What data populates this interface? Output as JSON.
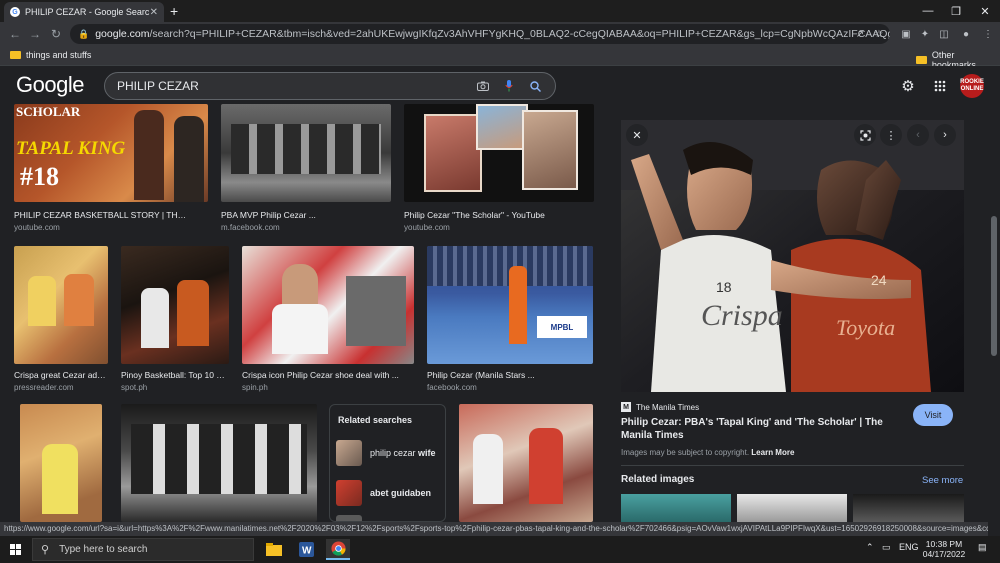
{
  "browser": {
    "tab_title": "PHILIP CEZAR - Google Search",
    "tab_close": "✕",
    "new_tab": "+",
    "window_controls": [
      "—",
      "❐",
      "✕"
    ],
    "url_host": "google.com",
    "url_path": "/search?q=PHILIP+CEZAR&tbm=isch&ved=2ahUKEwjwgIKfqZv3AhVHFYgKHQ_0BLAQ2-cCegQIABAA&oq=PHILIP+CEZAR&gs_lcp=CgNpbWcQAzIFCAAQgAQyBQgAEIAEMg...",
    "bookmarks": [
      "things and stuffs",
      "Other bookmarks"
    ]
  },
  "google": {
    "logo": "Google",
    "query": "PHILIP CEZAR",
    "profile_badge": "ROOKIE ONLINE"
  },
  "results": [
    {
      "caption": "PHILIP CEZAR BASKETBALL STORY | THE ...",
      "source": "youtube.com",
      "overlay_top": "SCHOLAR",
      "overlay_mid": "TAPAL KING",
      "overlay_num": "#18"
    },
    {
      "caption": "PBA MVP Philip Cezar ...",
      "source": "m.facebook.com"
    },
    {
      "caption": "Philip Cezar \"The Scholar\" - YouTube",
      "source": "youtube.com"
    },
    {
      "caption": "Crispa great Cezar advi...",
      "source": "pressreader.com"
    },
    {
      "caption": "Pinoy Basketball: Top 10 Pl...",
      "source": "spot.ph"
    },
    {
      "caption": "Crispa icon Philip Cezar shoe deal with ...",
      "source": "spin.ph"
    },
    {
      "caption": "Philip Cezar (Manila Stars ...",
      "source": "facebook.com"
    }
  ],
  "related_searches": {
    "title": "Related searches",
    "items": [
      {
        "prefix": "philip cezar ",
        "bold": "wife"
      },
      {
        "prefix": "",
        "bold": "abet guidaben"
      }
    ]
  },
  "preview": {
    "source_name": "The Manila Times",
    "title": "Philip Cezar: PBA's 'Tapal King' and 'The Scholar' | The Manila Times",
    "visit_label": "Visit",
    "copyright_note": "Images may be subject to copyright.",
    "learn_more": "Learn More",
    "related_images_label": "Related images",
    "see_more": "See more",
    "jersey_text": "Crispa",
    "jersey_number": "18",
    "opponent_number": "24",
    "opponent_jersey_text": "Toyota"
  },
  "status_url": "https://www.google.com/url?sa=i&url=https%3A%2F%2Fwww.manilatimes.net%2F2020%2F03%2F12%2Fsports%2Fsports-top%2Fphilip-cezar-pbas-tapal-king-and-the-scholar%2F702466&psig=AOvVaw1wxjAVIPAtLLa9PIPFIwqX&ust=16502926918250008&source=images&cd=vfe...",
  "taskbar": {
    "search_placeholder": "Type here to search",
    "language": "ENG",
    "time": "10:38 PM",
    "date": "04/17/2022"
  },
  "colors": {
    "accent": "#8ab4f8",
    "background": "#202124"
  }
}
